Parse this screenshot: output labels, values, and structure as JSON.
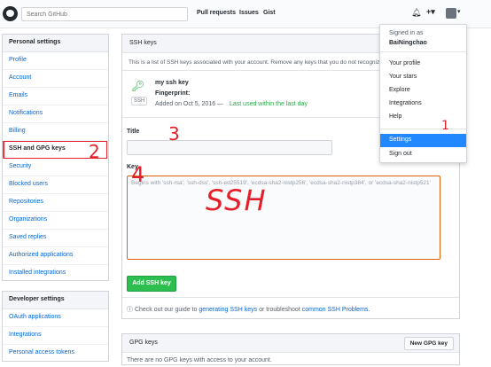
{
  "header": {
    "search_placeholder": "Search GitHub",
    "nav": [
      "Pull requests",
      "Issues",
      "Gist"
    ],
    "plus_label": "+▾"
  },
  "sidebar": {
    "personal_title": "Personal settings",
    "items": [
      "Profile",
      "Account",
      "Emails",
      "Notifications",
      "Billing",
      "SSH and GPG keys",
      "Security",
      "Blocked users",
      "Repositories",
      "Organizations",
      "Saved replies",
      "Authorized applications",
      "Installed integrations"
    ],
    "developer_title": "Developer settings",
    "dev_items": [
      "OAuth applications",
      "Integrations",
      "Personal access tokens"
    ]
  },
  "ssh": {
    "title": "SSH keys",
    "description": "This is a list of SSH keys associated with your account. Remove any keys that you do not recognize.",
    "key_name": "my ssh key",
    "fingerprint_label": "Fingerprint:",
    "badge": "SSH",
    "added": "Added on Oct 5, 2016 —",
    "last_used": "Last used within the last day",
    "title_label": "Title",
    "key_label": "Key",
    "key_placeholder": "Begins with 'ssh-rsa', 'ssh-dss', 'ssh-ed25519', 'ecdsa-sha2-nistp256', 'ecdsa-sha2-nistp384', or 'ecdsa-sha2-nistp521'",
    "add_button": "Add SSH key",
    "guide_prefix": "Check out our guide to",
    "guide_link": "generating SSH keys",
    "guide_middle": "or troubleshoot",
    "guide_link2": "common SSH Problems",
    "guide_end": "."
  },
  "gpg": {
    "title": "GPG keys",
    "new_button": "New GPG key",
    "empty": "There are no GPG keys with access to your account."
  },
  "menu": {
    "signed_in": "Signed in as",
    "username": "BaiNingchao",
    "items": [
      "Your profile",
      "Your stars",
      "Explore",
      "Integrations",
      "Help",
      "Settings",
      "Sign out"
    ]
  },
  "annotations": {
    "step1": "1",
    "step2": "2",
    "step3": "3",
    "step4": "4",
    "ssh_text": "SSH"
  },
  "colors": {
    "link": "#0366d6",
    "green": "#28a745",
    "highlight": "#2188ff",
    "annotation_red": "#e5202a"
  }
}
